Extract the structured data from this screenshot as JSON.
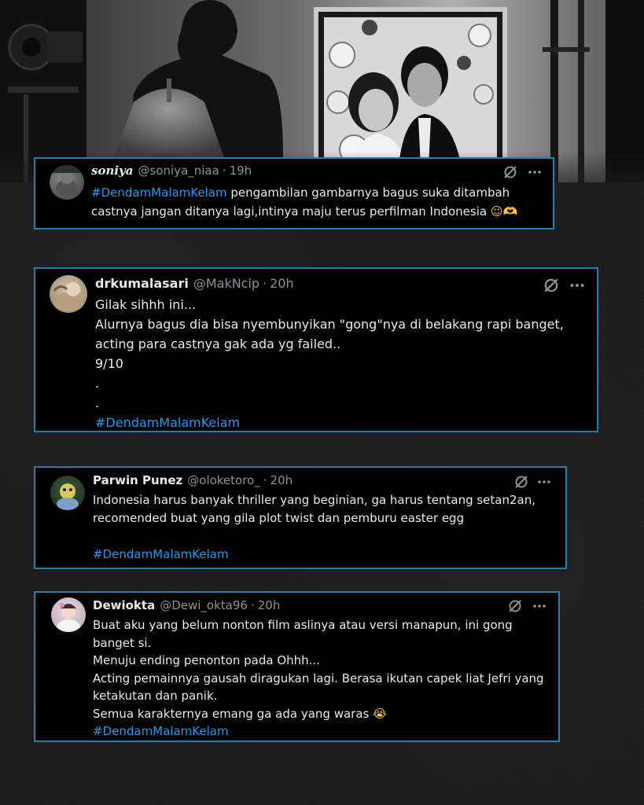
{
  "tweets": [
    {
      "name": "soniya",
      "handle": "@soniya_niaa",
      "separator": "·",
      "time": "19h",
      "hashtag": "#DendamMalamKelam",
      "first_line_rest": " pengambilan gambarnya bagus suka ditambah",
      "lines": [
        "castnya jangan ditanya lagi,intinya maju terus perfilman Indonesia"
      ],
      "emoji": "☺🫶"
    },
    {
      "name": "drkumalasari",
      "handle": "@MakNcip",
      "separator": "·",
      "time": "20h",
      "lines": [
        "Gilak sihhh ini...",
        "Alurnya bagus dia bisa nyembunyikan \"gong\"nya di belakang rapi banget,",
        "acting para castnya gak ada yg failed..",
        "9/10",
        ".",
        "."
      ],
      "hashtag": "#DendamMalamKelam"
    },
    {
      "name": "Parwin Punez",
      "handle": "@oloketoro_",
      "separator": "·",
      "time": "20h",
      "lines": [
        "Indonesia harus banyak thriller yang beginian, ga harus tentang setan2an,",
        "recomended buat yang gila plot twist dan pemburu easter egg"
      ],
      "hashtag": "#DendamMalamKelam"
    },
    {
      "name": "Dewiokta",
      "handle": "@Dewi_okta96",
      "separator": "·",
      "time": "20h",
      "lines": [
        "Buat aku yang belum nonton film aslinya atau versi manapun, ini gong",
        "banget si.",
        "Menuju ending penonton pada Ohhh...",
        "Acting pemainnya gausah diragukan lagi. Berasa ikutan capek liat Jefri yang",
        "ketakutan dan panik.",
        "Semua karakternya emang ga ada yang waras"
      ],
      "emoji": "😭",
      "hashtag": "#DendamMalamKelam"
    }
  ],
  "icons": {
    "grok": "grok-icon",
    "more": "more-icon"
  },
  "colors": {
    "background": "#1c1c1c",
    "card": "#000000",
    "border": "#1f7fb0",
    "hashtag": "#1d9bf0",
    "text": "#e7e9ea",
    "muted": "#8b9399"
  }
}
